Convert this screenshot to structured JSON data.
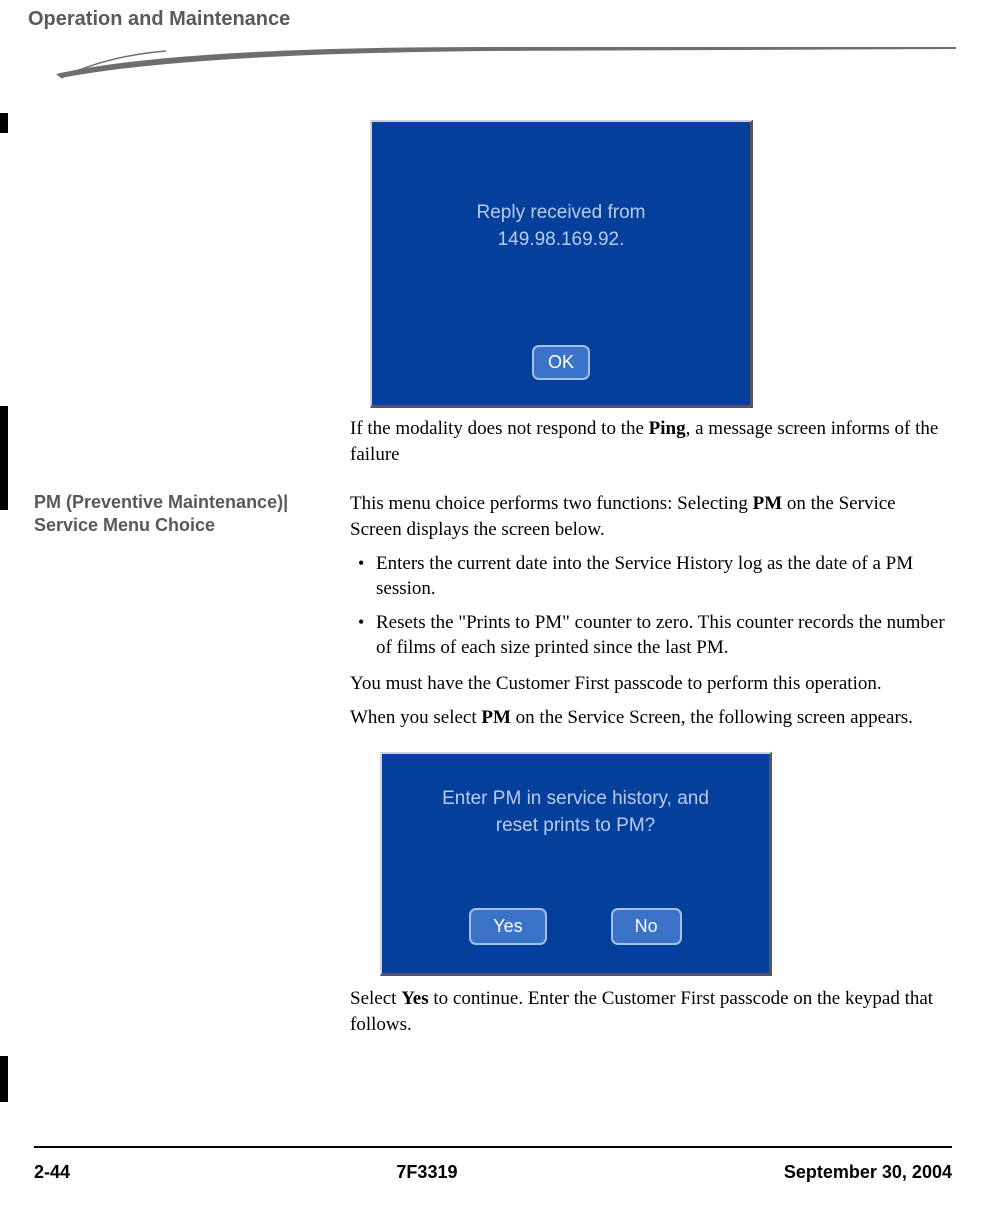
{
  "header": {
    "title": "Operation and Maintenance"
  },
  "dialog1": {
    "line1": "Reply received from",
    "line2": "149.98.169.92.",
    "ok": "OK"
  },
  "caption1_pre": "If the modality does not respond to the ",
  "caption1_bold": "Ping",
  "caption1_post": ", a message screen informs of the failure",
  "sidehead": "PM (Preventive Maintenance)| Service Menu Choice",
  "body": {
    "intro_pre": "This menu choice performs two functions: Selecting ",
    "intro_bold": "PM",
    "intro_post": " on the Service Screen displays the screen below.",
    "bullets": [
      "Enters the current date into the Service History log as the date of a PM session.",
      "Resets the \"Prints to PM\" counter to zero. This counter records the number of films of each size printed since the last PM."
    ],
    "passcode": "You must have the Customer First passcode to perform this operation.",
    "when_pre": "When you select ",
    "when_bold": "PM",
    "when_post": " on the Service Screen, the following screen appears."
  },
  "dialog2": {
    "line1": "Enter PM in service history, and",
    "line2": "reset prints to PM?",
    "yes": "Yes",
    "no": "No"
  },
  "caption2_pre": "Select ",
  "caption2_bold": "Yes",
  "caption2_post": " to continue. Enter the Customer First passcode on the keypad that follows.",
  "footer": {
    "page": "2-44",
    "doc": "7F3319",
    "date": "September 30, 2004"
  }
}
